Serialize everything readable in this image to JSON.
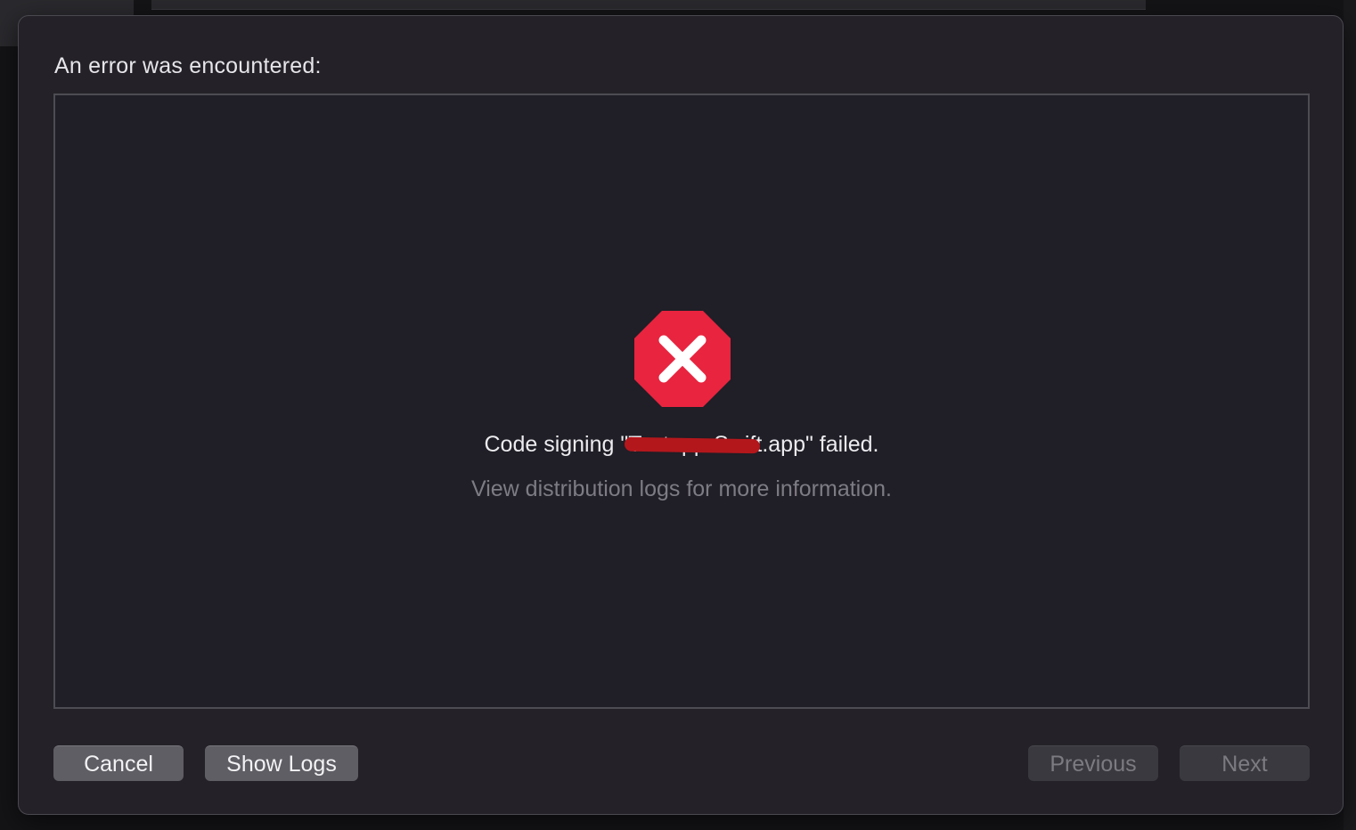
{
  "dialog": {
    "heading": "An error was encountered:",
    "message": {
      "prefix": "Code signing \"",
      "redacted_part": "Testapp-Swift",
      "suffix": ".app\" failed."
    },
    "detail": "View distribution logs for more information.",
    "icon": "error-stop-icon",
    "colors": {
      "icon_fill": "#e8243f",
      "redaction": "#b3171c"
    }
  },
  "buttons": {
    "cancel": "Cancel",
    "show_logs": "Show Logs",
    "previous": "Previous",
    "next": "Next"
  }
}
